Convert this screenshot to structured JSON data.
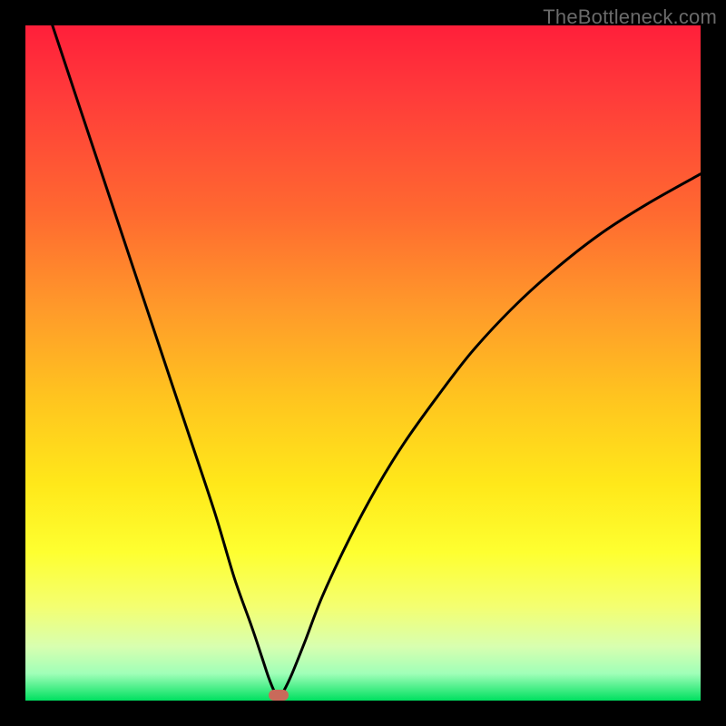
{
  "watermark": "TheBottleneck.com",
  "colors": {
    "frame": "#000000",
    "curve_stroke": "#000000",
    "marker_fill": "#c96a5a"
  },
  "chart_data": {
    "type": "line",
    "title": "",
    "xlabel": "",
    "ylabel": "",
    "xlim": [
      0,
      100
    ],
    "ylim": [
      0,
      100
    ],
    "grid": false,
    "legend": null,
    "notes": "No axis ticks or numeric labels are visible; x/y values are approximate, read from pixel positions relative to the plot area. Curve is V-shaped with minimum near x≈37.",
    "series": [
      {
        "name": "curve",
        "x": [
          4.0,
          8.0,
          12.0,
          16.0,
          20.0,
          24.0,
          28.0,
          31.0,
          33.5,
          35.0,
          36.0,
          36.8,
          37.5,
          38.3,
          39.5,
          41.5,
          44.0,
          48.0,
          52.0,
          56.0,
          61.0,
          66.0,
          72.0,
          78.0,
          85.0,
          92.0,
          100.0
        ],
        "values": [
          100.0,
          88.0,
          76.0,
          64.0,
          52.0,
          40.0,
          28.0,
          18.0,
          11.0,
          6.5,
          3.5,
          1.5,
          0.4,
          1.5,
          4.0,
          9.0,
          15.5,
          24.0,
          31.5,
          38.0,
          45.0,
          51.5,
          58.0,
          63.5,
          69.0,
          73.5,
          78.0
        ]
      }
    ],
    "marker": {
      "x": 37.5,
      "y": 0.8,
      "shape": "rounded-rect"
    }
  }
}
